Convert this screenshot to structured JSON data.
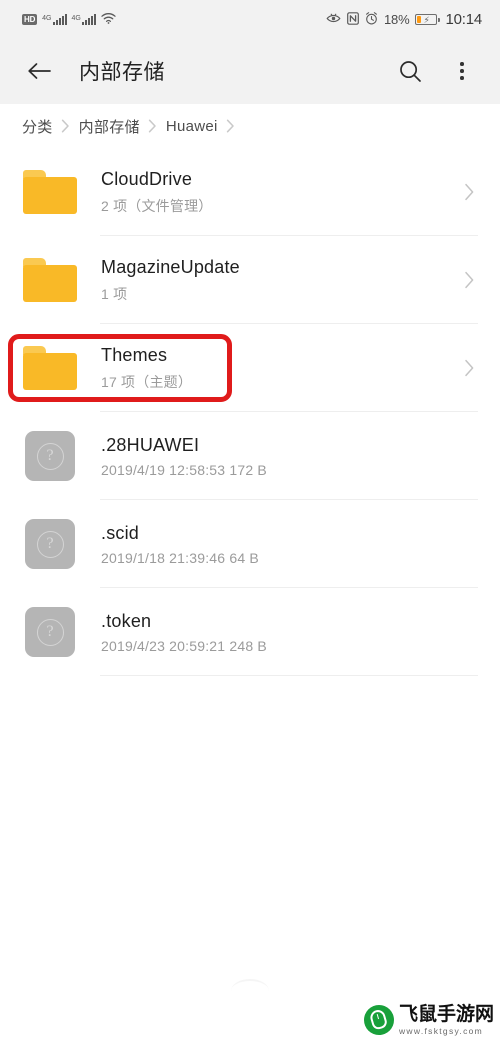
{
  "status_bar": {
    "hd_badge": "HD",
    "sim1_network": "4G",
    "sim2_network": "4G",
    "wifi_icon": "wifi-icon",
    "eye_icon": "eye-comfort-icon",
    "nfc_icon": "nfc-icon",
    "alarm_icon": "alarm-clock-icon",
    "battery_percent": "18%",
    "battery_level": 18,
    "battery_icon": "battery-charging-icon",
    "clock": "10:14"
  },
  "app_bar": {
    "back_icon": "back-arrow-icon",
    "title": "内部存储",
    "search_icon": "search-icon",
    "more_icon": "more-vertical-icon"
  },
  "breadcrumb": {
    "items": [
      {
        "label": "分类"
      },
      {
        "label": "内部存储"
      },
      {
        "label": "Huawei"
      }
    ],
    "separator_icon": "chevron-right-icon"
  },
  "file_list": {
    "chevron_icon": "chevron-right-icon",
    "items": [
      {
        "name": "CloudDrive",
        "meta": "2 项（文件管理）",
        "icon": "folder-icon",
        "highlighted": false
      },
      {
        "name": "MagazineUpdate",
        "meta": "1 项",
        "icon": "folder-icon",
        "highlighted": false
      },
      {
        "name": "Themes",
        "meta": "17 项（主题）",
        "icon": "folder-icon",
        "highlighted": true
      },
      {
        "name": ".28HUAWEI",
        "meta": "2019/4/19 12:58:53 172 B",
        "icon": "unknown-file-icon",
        "highlighted": false
      },
      {
        "name": ".scid",
        "meta": "2019/1/18 21:39:46 64 B",
        "icon": "unknown-file-icon",
        "highlighted": false
      },
      {
        "name": ".token",
        "meta": "2019/4/23 20:59:21 248 B",
        "icon": "unknown-file-icon",
        "highlighted": false
      }
    ]
  },
  "annotation": {
    "highlight_color": "#e01b1b",
    "target": "Themes"
  },
  "watermark": {
    "title": "飞鼠手游网",
    "url": "www.fsktgsy.com",
    "logo_icon": "mouse-logo-icon",
    "logo_color": "#18a03a"
  },
  "colors": {
    "folder": "#f9b927",
    "folder_tab": "#fac951",
    "unknown_file": "#b5b5b5",
    "status_bg": "#f2f2f2",
    "battery_accent": "#ff9a11"
  }
}
